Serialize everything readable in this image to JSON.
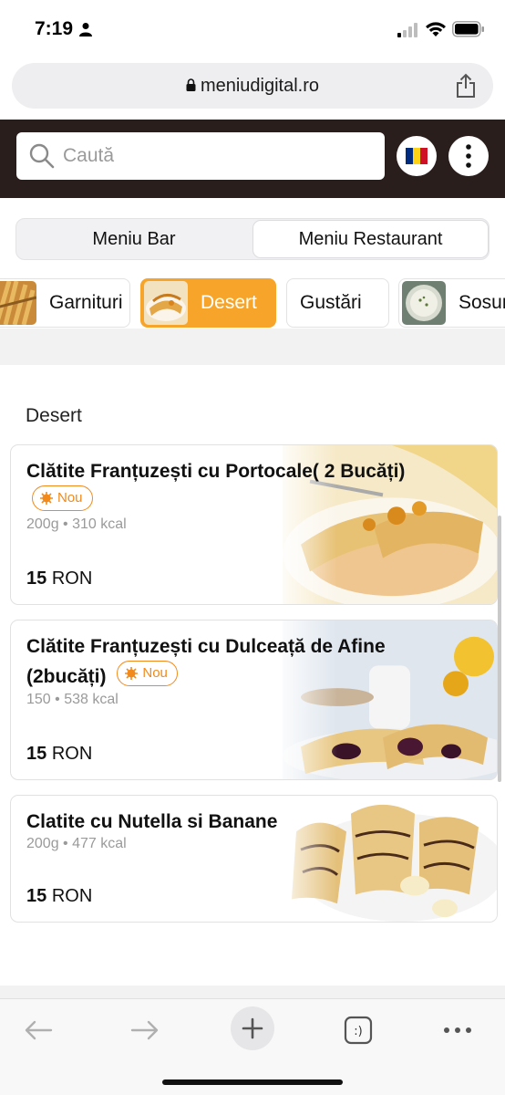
{
  "status": {
    "time": "7:19"
  },
  "browser": {
    "url": "meniudigital.ro"
  },
  "header": {
    "search_placeholder": "Caută",
    "colors": {
      "background": "#2a1e1c",
      "accent": "#f7a52a"
    }
  },
  "tabs": [
    {
      "label": "Meniu Bar",
      "selected": false
    },
    {
      "label": "Meniu Restaurant",
      "selected": true
    }
  ],
  "categories": [
    {
      "label": "Garnituri",
      "active": false,
      "icon": "fries-thumb"
    },
    {
      "label": "Desert",
      "active": true,
      "icon": "crepes-thumb"
    },
    {
      "label": "Gustări",
      "active": false,
      "icon": ""
    },
    {
      "label": "Sosuri",
      "active": false,
      "icon": "sauce-thumb"
    }
  ],
  "section": {
    "title": "Desert"
  },
  "products": [
    {
      "name": "Clătite Franțuzești cu Portocale( 2 Bucăți)",
      "badge": "Nou",
      "meta": "200g • 310 kcal",
      "price_value": "15",
      "price_currency": "RON"
    },
    {
      "name": "Clătite Franțuzești cu Dulceață de Afine (2bucăți)",
      "badge": "Nou",
      "meta": "150 • 538 kcal",
      "price_value": "15",
      "price_currency": "RON"
    },
    {
      "name": "Clatite cu Nutella si Banane",
      "badge": "",
      "meta": "200g • 477 kcal",
      "price_value": "15",
      "price_currency": "RON"
    }
  ],
  "toolbar": {
    "tabs_label": ":)"
  }
}
